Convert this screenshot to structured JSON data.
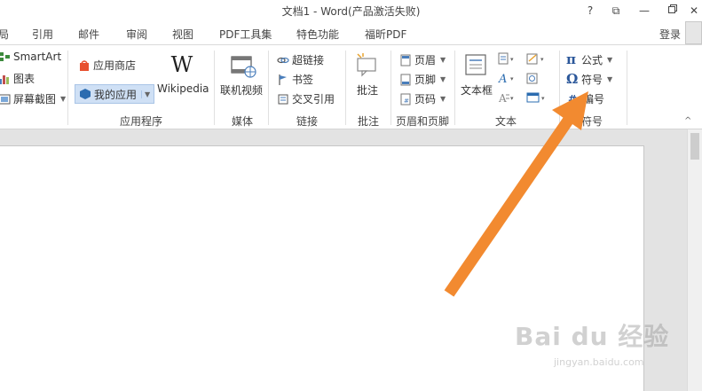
{
  "window": {
    "title": "文档1 - Word(产品激活失败)",
    "help_label": "?",
    "restore_ribbon_label": "⧉",
    "minimize_label": "—",
    "close_label": "✕"
  },
  "tabs": [
    {
      "label": "局"
    },
    {
      "label": "引用"
    },
    {
      "label": "邮件"
    },
    {
      "label": "审阅"
    },
    {
      "label": "视图"
    },
    {
      "label": "PDF工具集"
    },
    {
      "label": "特色功能"
    },
    {
      "label": "福昕PDF"
    }
  ],
  "account": {
    "login_label": "登录"
  },
  "ribbon": {
    "illustrations": {
      "smartart_label": "SmartArt",
      "chart_label": "图表",
      "screenshot_label": "屏幕截图"
    },
    "apps": {
      "store_label": "应用商店",
      "myapps_label": "我的应用",
      "wikipedia_label": "Wikipedia",
      "group_label": "应用程序"
    },
    "media": {
      "online_video_label": "联机视频",
      "group_label": "媒体"
    },
    "links": {
      "hyperlink_label": "超链接",
      "bookmark_label": "书签",
      "crossref_label": "交叉引用",
      "group_label": "链接"
    },
    "comments": {
      "comment_label": "批注",
      "group_label": "批注"
    },
    "header_footer": {
      "header_label": "页眉",
      "footer_label": "页脚",
      "page_number_label": "页码",
      "group_label": "页眉和页脚"
    },
    "text": {
      "textbox_label": "文本框",
      "group_label": "文本"
    },
    "symbols": {
      "equation_label": "公式",
      "symbol_label": "符号",
      "number_label": "编号",
      "group_label": "符号"
    }
  },
  "watermark": {
    "brand_label": "Bai du 经验",
    "url_label": "jingyan.baidu.com"
  },
  "colors": {
    "arrow": "#f28a30",
    "accent": "#2b579a"
  }
}
